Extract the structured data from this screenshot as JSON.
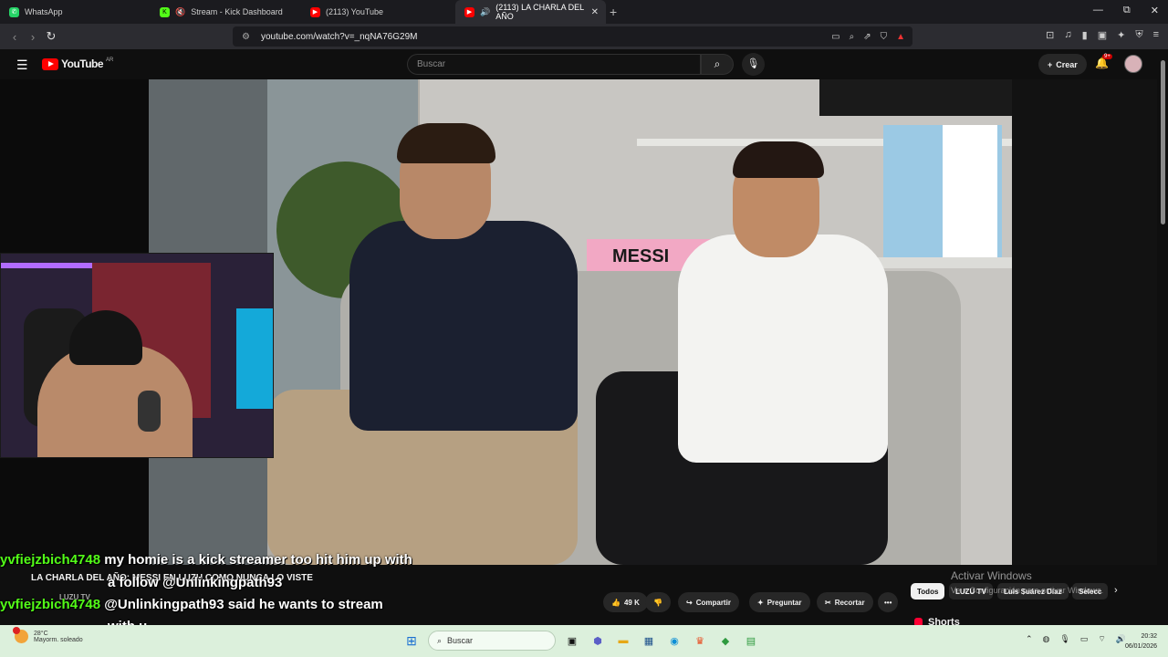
{
  "browser": {
    "tabs": [
      {
        "label": "WhatsApp",
        "icon": "whatsapp-icon",
        "color": "#25d366",
        "active": false
      },
      {
        "label": "Stream - Kick Dashboard",
        "icon": "kick-icon",
        "color": "#53fc18",
        "active": false
      },
      {
        "label": "(2113) YouTube",
        "icon": "youtube-icon",
        "color": "#ff0000",
        "active": false
      },
      {
        "label": "(2113) LA CHARLA DEL AÑO",
        "icon": "youtube-icon",
        "color": "#ff0000",
        "active": true
      }
    ],
    "window_controls": [
      "—",
      "⧉",
      "✕"
    ],
    "url": "youtube.com/watch?v=_nqNA76G29M"
  },
  "youtube": {
    "logo_text": "YouTube",
    "country_code": "AR",
    "search_placeholder": "Buscar",
    "create_label": "Crear",
    "notification_badge": "9+"
  },
  "video": {
    "jersey_text": "MESSI",
    "title": "LA CHARLA DEL AÑO: MESSI EN LUZU COMO NUNCA LO VISTE",
    "channel": "LUZU TV",
    "likes": "49 K",
    "share_label": "Compartir",
    "ask_label": "Preguntar",
    "clip_label": "Recortar",
    "more_label": "•••"
  },
  "chat": [
    {
      "user": "yvfiejzbich4748",
      "message": "my homie is a kick streamer too hit him up with"
    },
    {
      "user": "",
      "message": "a follow @Unlinkingpath93"
    },
    {
      "user": "yvfiejzbich4748",
      "message": "@Unlinkingpath93 said he wants to stream"
    },
    {
      "user": "",
      "message": "with u"
    }
  ],
  "sidebar": {
    "chips": [
      "Todos",
      "LUZU TV",
      "Luis Suárez Díaz",
      "Selecc"
    ],
    "shorts_label": "Shorts"
  },
  "windows_watermark": {
    "title": "Activar Windows",
    "subtitle": "Ve a Configuración para activar Windows."
  },
  "taskbar": {
    "temperature": "28°C",
    "weather_desc": "Mayorm. soleado",
    "search_placeholder": "Buscar",
    "time": "20:32",
    "date": "06/01/2026"
  }
}
